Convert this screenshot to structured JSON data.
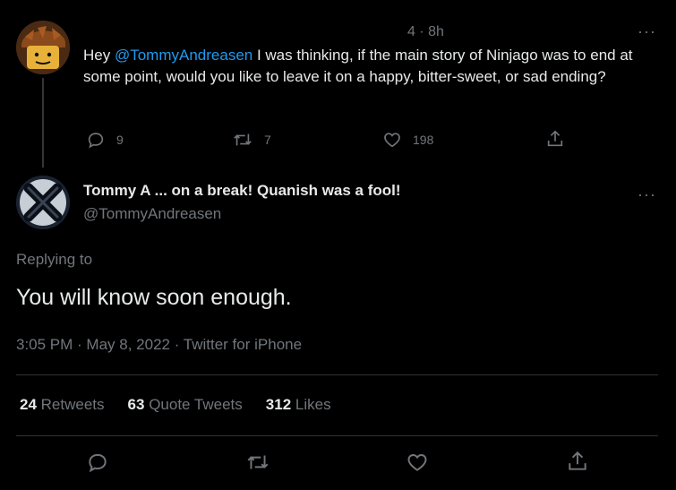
{
  "reply_tweet": {
    "meta": "4 · 8h",
    "text_parts": {
      "before": "Hey ",
      "mention": "@TommyAndreasen",
      "after": " I was thinking, if the main story of Ninjago was to end at some point, would you like to leave it on a happy, bitter-sweet, or sad ending?"
    },
    "reply_count": "9",
    "retweet_count": "7",
    "like_count": "198",
    "more_label": "···"
  },
  "main_tweet": {
    "display_name": "Tommy A ... on a break! Quanish was a fool!",
    "handle": "@TommyAndreasen",
    "replying_to": "Replying to",
    "text": "You will know soon enough.",
    "timestamp": "3:05 PM · May 8, 2022 · Twitter for iPhone",
    "more_label": "···",
    "stats": {
      "retweets_count": "24",
      "retweets_label": "Retweets",
      "quote_count": "63",
      "quote_label": "Quote Tweets",
      "likes_count": "312",
      "likes_label": "Likes"
    }
  },
  "colors": {
    "background": "#000000",
    "text": "#e7e9ea",
    "muted": "#71767b",
    "link": "#1d9bf0",
    "divider": "#2f3336"
  },
  "icons": [
    "reply-icon",
    "retweet-icon",
    "like-icon",
    "share-icon",
    "more-icon"
  ]
}
